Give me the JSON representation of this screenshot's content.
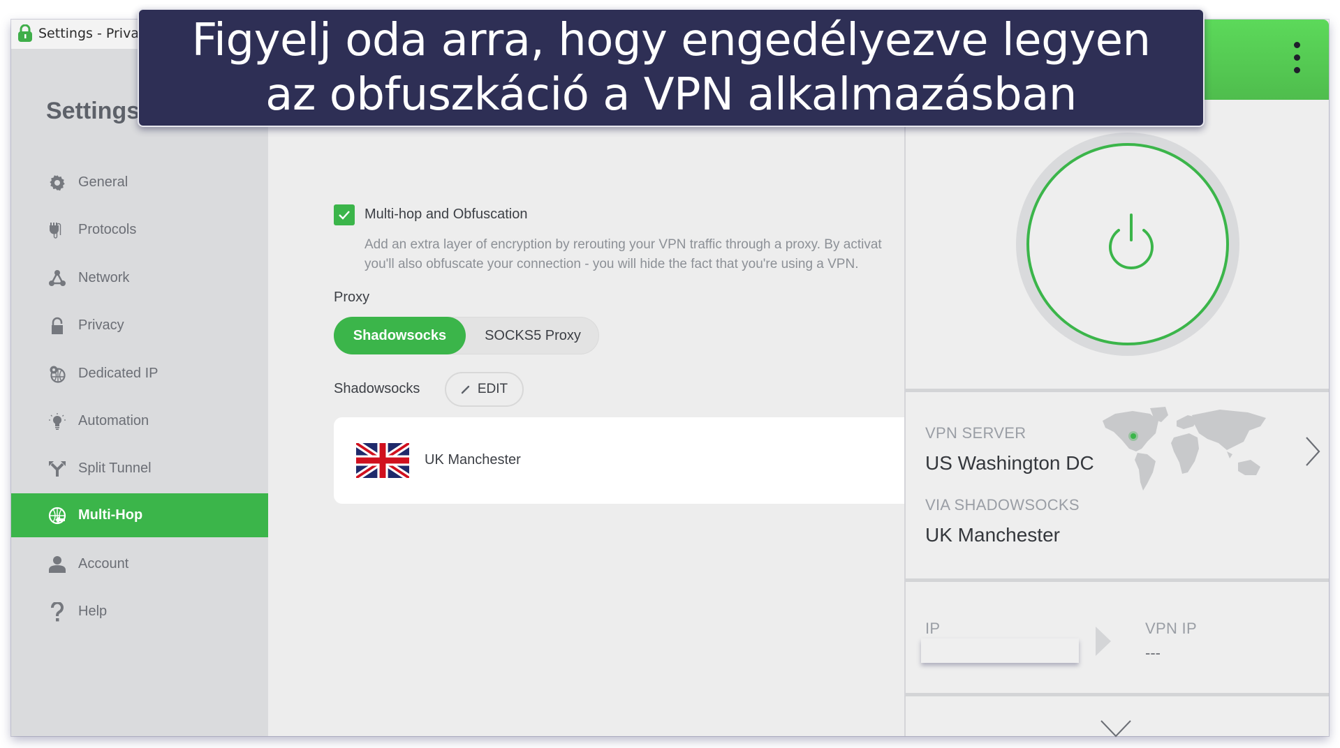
{
  "window": {
    "title": "Settings - Private"
  },
  "banner": {
    "line1": "Figyelj oda arra, hogy engedélyezve legyen",
    "line2": "az obfuszkáció a VPN alkalmazásban"
  },
  "sidebar": {
    "heading": "Settings",
    "items": [
      {
        "label": "General",
        "icon": "gear-icon",
        "active": false
      },
      {
        "label": "Protocols",
        "icon": "plug-icon",
        "active": false
      },
      {
        "label": "Network",
        "icon": "network-icon",
        "active": false
      },
      {
        "label": "Privacy",
        "icon": "lock-icon",
        "active": false
      },
      {
        "label": "Dedicated IP",
        "icon": "dedicated-ip-icon",
        "active": false
      },
      {
        "label": "Automation",
        "icon": "lightbulb-icon",
        "active": false
      },
      {
        "label": "Split Tunnel",
        "icon": "split-tunnel-icon",
        "active": false
      },
      {
        "label": "Multi-Hop",
        "icon": "globe-icon",
        "active": true
      },
      {
        "label": "Account",
        "icon": "user-icon",
        "active": false
      },
      {
        "label": "Help",
        "icon": "question-icon",
        "active": false
      }
    ]
  },
  "main": {
    "multihop_checkbox": {
      "label": "Multi-hop and Obfuscation",
      "checked": true
    },
    "description": [
      "Add an extra layer of encryption by rerouting your VPN traffic through a proxy. By activat",
      "you'll also obfuscate your connection - you will hide the fact that you're using a VPN."
    ],
    "proxy_label": "Proxy",
    "proxy_options": [
      "Shadowsocks",
      "SOCKS5 Proxy"
    ],
    "proxy_selected": "Shadowsocks",
    "shadowsocks_label": "Shadowsocks",
    "edit_label": "EDIT",
    "selected_server": "UK Manchester"
  },
  "vpn_panel": {
    "colors": {
      "accent": "#3bb54a",
      "header": "#55c853"
    },
    "vpn_server_caption": "VPN SERVER",
    "vpn_server_value": "US Washington DC",
    "via_caption": "VIA SHADOWSOCKS",
    "via_value": "UK Manchester",
    "ip_caption": "IP",
    "ip_value": "",
    "vpn_ip_caption": "VPN IP",
    "vpn_ip_value": "---"
  }
}
